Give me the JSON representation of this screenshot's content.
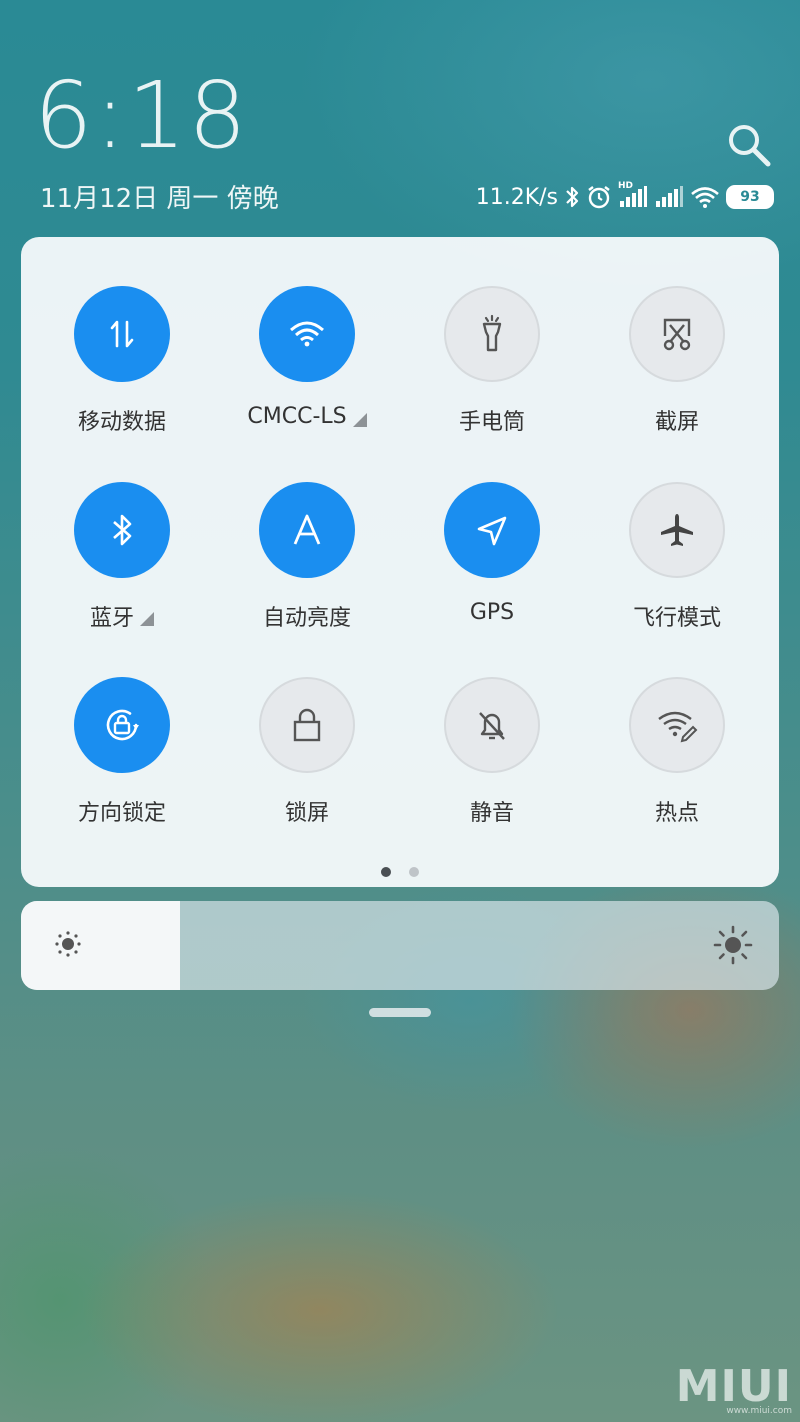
{
  "status": {
    "time": "6:18",
    "date": "11月12日 周一 傍晚",
    "net_speed": "11.2K/s",
    "signal_label": "HD",
    "battery": "93"
  },
  "icons": {
    "search": "search-icon",
    "bluetooth": "bluetooth-icon",
    "alarm": "alarm-icon",
    "signal": "signal-icon",
    "wifi": "wifi-icon"
  },
  "toggles": [
    {
      "label": "移动数据",
      "icon": "mobile-data-icon",
      "on": true,
      "expand": false
    },
    {
      "label": "CMCC-LS",
      "icon": "wifi-icon",
      "on": true,
      "expand": true
    },
    {
      "label": "手电筒",
      "icon": "flashlight-icon",
      "on": false,
      "expand": false
    },
    {
      "label": "截屏",
      "icon": "screenshot-icon",
      "on": false,
      "expand": false
    },
    {
      "label": "蓝牙",
      "icon": "bluetooth-icon",
      "on": true,
      "expand": true
    },
    {
      "label": "自动亮度",
      "icon": "auto-brightness-icon",
      "on": true,
      "expand": false
    },
    {
      "label": "GPS",
      "icon": "location-icon",
      "on": true,
      "expand": false
    },
    {
      "label": "飞行模式",
      "icon": "airplane-icon",
      "on": false,
      "expand": false
    },
    {
      "label": "方向锁定",
      "icon": "rotation-lock-icon",
      "on": true,
      "expand": false
    },
    {
      "label": "锁屏",
      "icon": "lock-icon",
      "on": false,
      "expand": false
    },
    {
      "label": "静音",
      "icon": "mute-bell-icon",
      "on": false,
      "expand": false
    },
    {
      "label": "热点",
      "icon": "hotspot-icon",
      "on": false,
      "expand": false
    }
  ],
  "pager": {
    "pages": 2,
    "current": 1
  },
  "brightness": {
    "level": 0.21
  },
  "watermark": {
    "brand": "MIUI",
    "url": "www.miui.com"
  },
  "colors": {
    "accent": "#1a8ef0",
    "off": "#e6e9ec"
  }
}
